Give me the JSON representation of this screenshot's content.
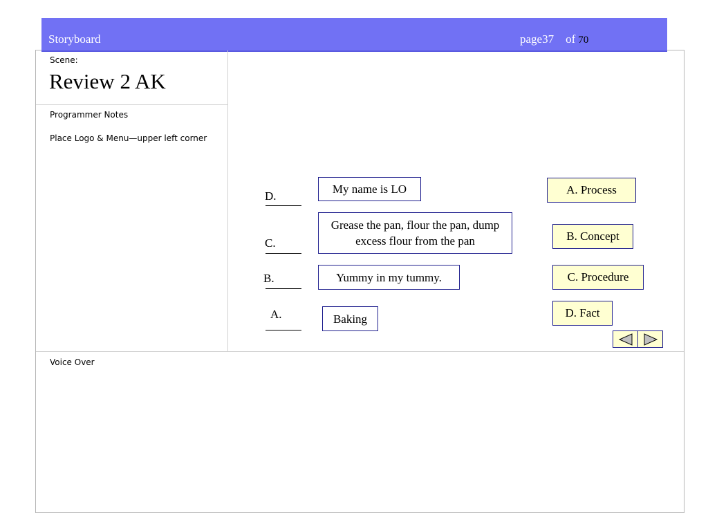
{
  "header": {
    "title": "Storyboard",
    "page_label": "page37",
    "of_label": "of",
    "total_pages": "70"
  },
  "scene": {
    "label": "Scene:",
    "title": "Review 2 AK"
  },
  "programmer_notes": {
    "label": "Programmer Notes",
    "text": "Place Logo & Menu—upper left corner"
  },
  "voice_over": {
    "label": "Voice Over"
  },
  "matching": {
    "letters": [
      "D.",
      "C.",
      "B.",
      "A."
    ],
    "examples": [
      "My name is LO",
      "Grease the pan, flour the pan, dump excess flour from the pan",
      "Yummy in my tummy.",
      "Baking"
    ],
    "choices": [
      "A.  Process",
      "B.  Concept",
      "C.  Procedure",
      "D.  Fact"
    ]
  },
  "nav": {
    "prev_icon": "triangle-left-icon",
    "next_icon": "triangle-right-icon",
    "color": "#c0c0c0"
  },
  "colors": {
    "header": "#7171f4",
    "answer_fill": "#ffffd2",
    "box_border": "#1c1c8c"
  }
}
